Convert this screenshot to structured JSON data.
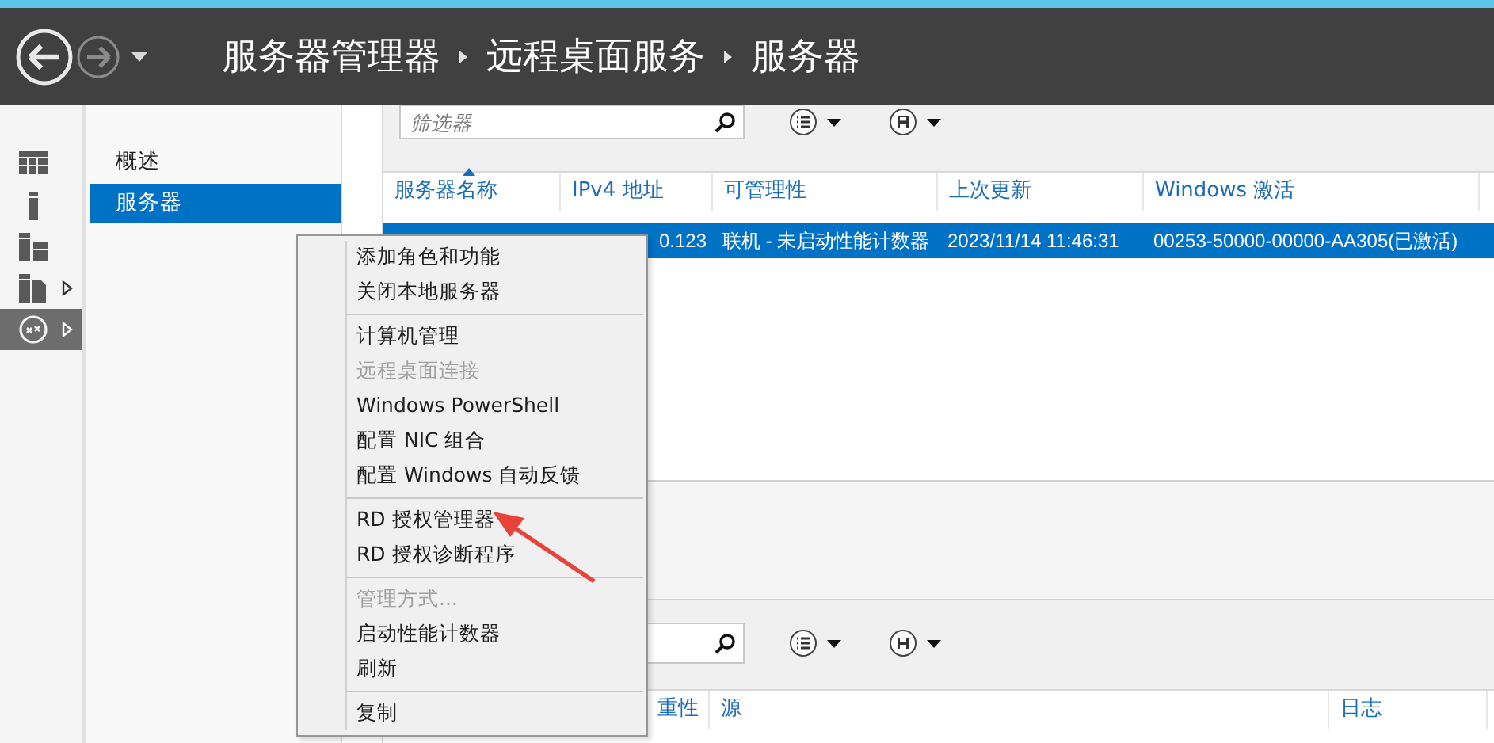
{
  "header": {
    "breadcrumb": [
      "服务器管理器",
      "远程桌面服务",
      "服务器"
    ]
  },
  "rail": [
    {
      "kind": "dashboard",
      "expandable": false,
      "selected": false
    },
    {
      "kind": "local-server",
      "expandable": false,
      "selected": false
    },
    {
      "kind": "all-servers",
      "expandable": false,
      "selected": false
    },
    {
      "kind": "file-services",
      "expandable": true,
      "selected": false
    },
    {
      "kind": "remote-desktop",
      "expandable": true,
      "selected": true
    }
  ],
  "nav": [
    {
      "label": "概述",
      "selected": false
    },
    {
      "label": "服务器",
      "selected": true
    }
  ],
  "servers": {
    "filter": {
      "placeholder": "筛选器"
    },
    "columns": [
      {
        "label": "服务器名称",
        "sorted": true
      },
      {
        "label": "IPv4 地址",
        "sorted": false
      },
      {
        "label": "可管理性",
        "sorted": false
      },
      {
        "label": "上次更新",
        "sorted": false
      },
      {
        "label": "Windows 激活",
        "sorted": false
      }
    ],
    "rows": [
      {
        "selected": true,
        "cells": [
          "",
          "0.123",
          "联机 - 未启动性能计数器",
          "2023/11/14 11:46:31",
          "00253-50000-00000-AA305(已激活)"
        ]
      }
    ]
  },
  "events": {
    "columns": [
      {
        "label": "重性"
      },
      {
        "label": "源"
      },
      {
        "label": "日志"
      }
    ]
  },
  "context_menu": {
    "groups": [
      [
        {
          "label": "添加角色和功能",
          "disabled": false
        },
        {
          "label": "关闭本地服务器",
          "disabled": false
        }
      ],
      [
        {
          "label": "计算机管理",
          "disabled": false
        },
        {
          "label": "远程桌面连接",
          "disabled": true
        },
        {
          "label": "Windows PowerShell",
          "disabled": false
        },
        {
          "label": "配置 NIC 组合",
          "disabled": false
        },
        {
          "label": "配置 Windows 自动反馈",
          "disabled": false
        }
      ],
      [
        {
          "label": "RD 授权管理器",
          "disabled": false
        },
        {
          "label": "RD 授权诊断程序",
          "disabled": false
        }
      ],
      [
        {
          "label": "管理方式...",
          "disabled": true
        },
        {
          "label": "启动性能计数器",
          "disabled": false
        },
        {
          "label": "刷新",
          "disabled": false
        }
      ],
      [
        {
          "label": "复制",
          "disabled": false
        }
      ]
    ]
  }
}
